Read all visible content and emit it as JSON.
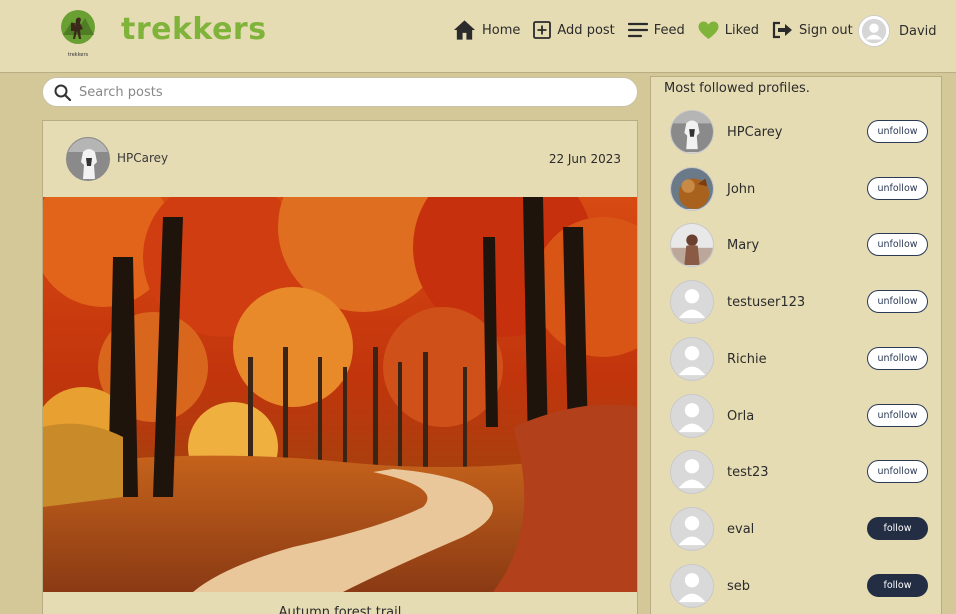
{
  "brand": {
    "name": "trekkers",
    "logo_caption": "trekkers",
    "color": "#7fb33a"
  },
  "nav": {
    "home": "Home",
    "add_post": "Add post",
    "feed": "Feed",
    "liked": "Liked",
    "sign_out": "Sign out",
    "user": "David"
  },
  "search": {
    "placeholder": "Search posts",
    "value": ""
  },
  "post": {
    "author": "HPCarey",
    "date": "22 Jun 2023",
    "title": "Autumn forest trail"
  },
  "sidebar": {
    "title": "Most followed profiles.",
    "profiles": [
      {
        "name": "HPCarey",
        "action": "unfollow",
        "avatar": "hpcarey"
      },
      {
        "name": "John",
        "action": "unfollow",
        "avatar": "john"
      },
      {
        "name": "Mary",
        "action": "unfollow",
        "avatar": "mary"
      },
      {
        "name": "testuser123",
        "action": "unfollow",
        "avatar": "default"
      },
      {
        "name": "Richie",
        "action": "unfollow",
        "avatar": "default"
      },
      {
        "name": "Orla",
        "action": "unfollow",
        "avatar": "default"
      },
      {
        "name": "test23",
        "action": "unfollow",
        "avatar": "default"
      },
      {
        "name": "eval",
        "action": "follow",
        "avatar": "default"
      },
      {
        "name": "seb",
        "action": "follow",
        "avatar": "default"
      }
    ]
  },
  "colors": {
    "background": "#d5c898",
    "panel": "#e6dcb4",
    "follow_button": "#232e44",
    "liked_heart": "#7fb33a"
  }
}
